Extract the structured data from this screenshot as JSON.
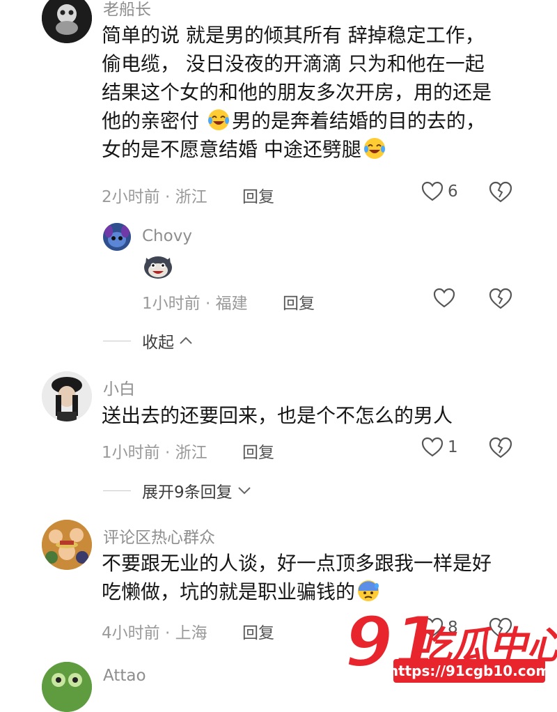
{
  "comments": [
    {
      "username": "老船长",
      "lines": [
        "简单的说  就是男的倾其所有  辞掉稳定工作，",
        "偷电缆，  没日没夜的开滴滴   只为和他在一起",
        "结果这个女的和他的朋友多次开房，用的还是",
        "他的亲密付",
        "男的是奔着结婚的目的去的，",
        "女的是不愿意结婚   中途还劈腿"
      ],
      "meta": "2小时前 · 浙江",
      "reply_label": "回复",
      "likes": "6"
    },
    {
      "username": "Chovy",
      "meta": "1小时前 · 福建",
      "reply_label": "回复",
      "likes": ""
    },
    {
      "username": "小白",
      "lines": [
        "送出去的还要回来，也是个不怎么的男人"
      ],
      "meta": "1小时前 · 浙江",
      "reply_label": "回复",
      "likes": "1"
    },
    {
      "username": "评论区热心群众",
      "lines": [
        "不要跟无业的人谈，好一点顶多跟我一样是好",
        "吃懒做，坑的就是职业骗钱的"
      ],
      "meta": "4小时前 · 上海",
      "reply_label": "回复",
      "likes": "8"
    },
    {
      "username": "Attao"
    }
  ],
  "toggles": {
    "collapse_label": "收起",
    "expand_label": "展开9条回复"
  },
  "watermark": {
    "number": "91",
    "name": "吃瓜中心",
    "url": "https://91cgb10.com"
  },
  "colors": {
    "text_primary": "#161616",
    "text_secondary": "#9a9a9a",
    "watermark_red": "#e8242c"
  },
  "icons": [
    "heart-outline-icon",
    "broken-heart-icon",
    "chevron-up-icon",
    "chevron-down-icon",
    "laughing-tears-emoji",
    "raccoon-sticker-icon",
    "cold-sweat-emoji"
  ]
}
